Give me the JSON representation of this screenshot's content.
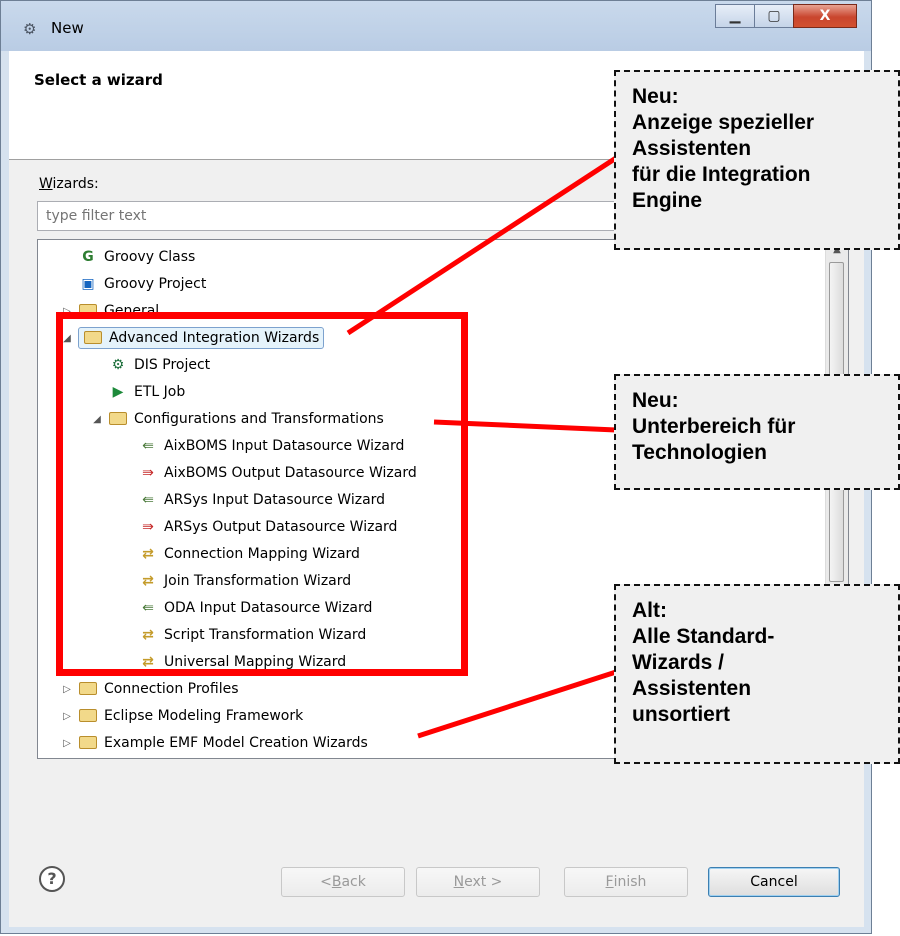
{
  "window": {
    "title": "New",
    "close_glyph": "X"
  },
  "header": {
    "title": "Select a wizard"
  },
  "wizards": {
    "label_underlined": "W",
    "label_rest": "izards:",
    "filter_placeholder": "type filter text"
  },
  "tree": {
    "groovy_class": "Groovy Class",
    "groovy_project": "Groovy Project",
    "general": "General",
    "advanced": "Advanced Integration Wizards",
    "dis_project": "DIS Project",
    "etl_job": "ETL Job",
    "config": "Configurations and Transformations",
    "aix_in": "AixBOMS Input Datasource Wizard",
    "aix_out": "AixBOMS Output Datasource Wizard",
    "ars_in": "ARSys Input Datasource Wizard",
    "ars_out": "ARSys Output Datasource Wizard",
    "conn_map": "Connection Mapping Wizard",
    "join": "Join Transformation Wizard",
    "oda_in": "ODA Input Datasource Wizard",
    "script": "Script Transformation Wizard",
    "universal": "Universal Mapping Wizard",
    "conn_profiles": "Connection Profiles",
    "emf": "Eclipse Modeling Framework",
    "example_emf": "Example EMF Model Creation Wizards"
  },
  "buttons": {
    "back_lt": "< ",
    "back_ul": "B",
    "back_rest": "ack",
    "next_ul": "N",
    "next_rest": "ext >",
    "finish_ul": "F",
    "finish_rest": "inish",
    "cancel": "Cancel",
    "help": "?"
  },
  "annotations": {
    "a1": [
      "Neu:",
      "Anzeige spezieller",
      "Assistenten",
      "für die Integration",
      "Engine"
    ],
    "a2": [
      "Neu:",
      "Unterbereich für",
      "Technologien"
    ],
    "a3": [
      "Alt:",
      "Alle Standard-",
      "Wizards /",
      "Assistenten",
      "unsortiert"
    ]
  },
  "colors": {
    "highlight": "#ff0000",
    "callout_border": "#111111"
  }
}
